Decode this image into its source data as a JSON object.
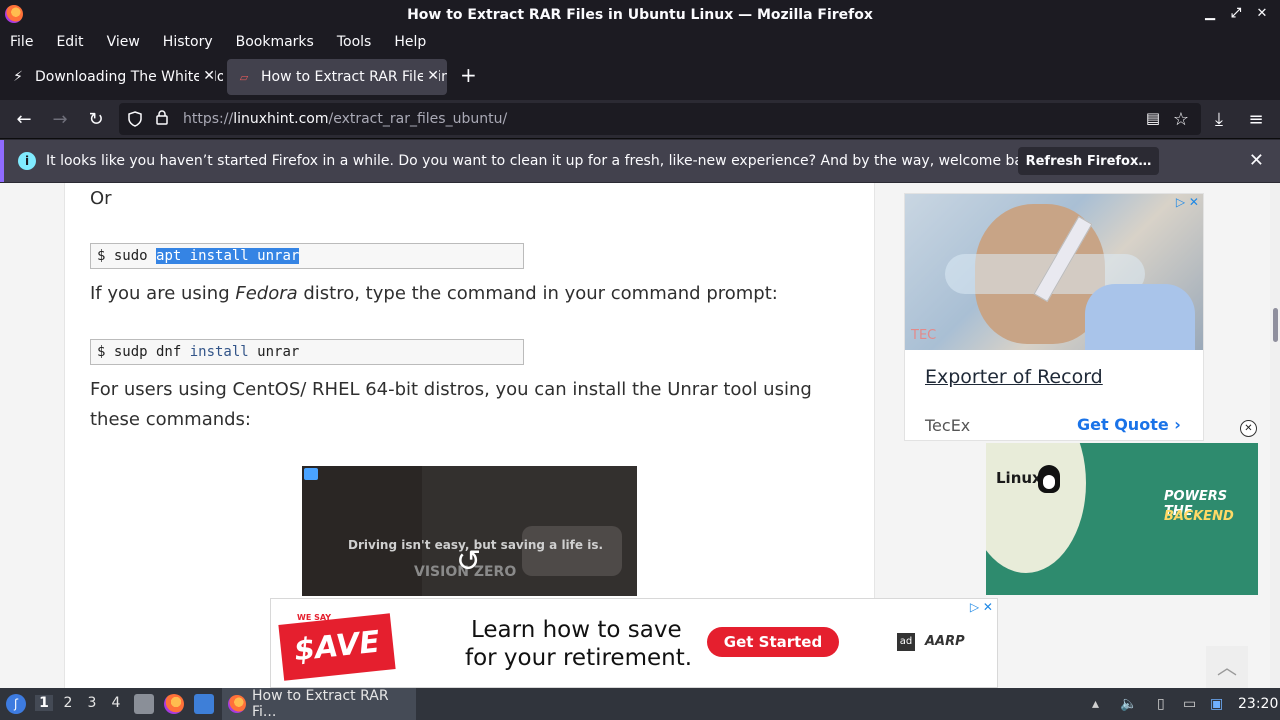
{
  "window": {
    "title": "How to Extract RAR Files in Ubuntu Linux — Mozilla Firefox",
    "controls": [
      "▁",
      "⤢",
      "✕"
    ]
  },
  "menu": [
    "File",
    "Edit",
    "View",
    "History",
    "Bookmarks",
    "Tools",
    "Help"
  ],
  "tabs": [
    {
      "label": "Downloading The White House",
      "icon": "lightning-icon",
      "active": false
    },
    {
      "label": "How to Extract RAR Files in Ubuntu",
      "icon": "linuxhint-favicon",
      "active": true
    }
  ],
  "nav": {
    "url_prefix": "https://",
    "url_domain": "linuxhint.com",
    "url_path": "/extract_rar_files_ubuntu/"
  },
  "notification": {
    "message": "It looks like you haven’t started Firefox in a while. Do you want to clean it up for a fresh, like-new experience? And by the way, welcome back!",
    "button": "Refresh Firefox…"
  },
  "article": {
    "or_text": "Or",
    "code1": {
      "prompt": "$ sudo",
      "selected": "apt install unrar"
    },
    "fedora_pre": "If you are using ",
    "fedora_em": "Fedora",
    "fedora_post": " distro, type the command in your command prompt:",
    "code2": {
      "prompt": "$ sudp dnf ",
      "kw": "install",
      "rest": " unrar"
    },
    "centos_line1": "For users using CentOS/ RHEL 64-bit distros, you can install the Unrar tool using",
    "centos_line2": "these commands:",
    "video_caption": "Driving isn't easy, but saving a life is.",
    "video_caption2": "VISION ZERO"
  },
  "ads": {
    "sidebar1": {
      "headline": "Exporter of Record",
      "brand": "TecEx",
      "cta": "Get Quote",
      "photo_mark": "TEC"
    },
    "sidebar2": {
      "logo": "Linux",
      "powers": "POWERS THE",
      "backend": "BACKEND"
    },
    "bottom": {
      "we_say": "WE SAY",
      "save_it": "$AVE IT",
      "line1": "Learn how to save",
      "line2": "for your retirement.",
      "cta": "Get Started",
      "badge": "ad",
      "sponsor": "AARP"
    }
  },
  "taskbar": {
    "workspaces": [
      "1",
      "2",
      "3",
      "4"
    ],
    "active_workspace": "1",
    "task_label": "How to Extract RAR Fi...",
    "clock": "23:20"
  }
}
